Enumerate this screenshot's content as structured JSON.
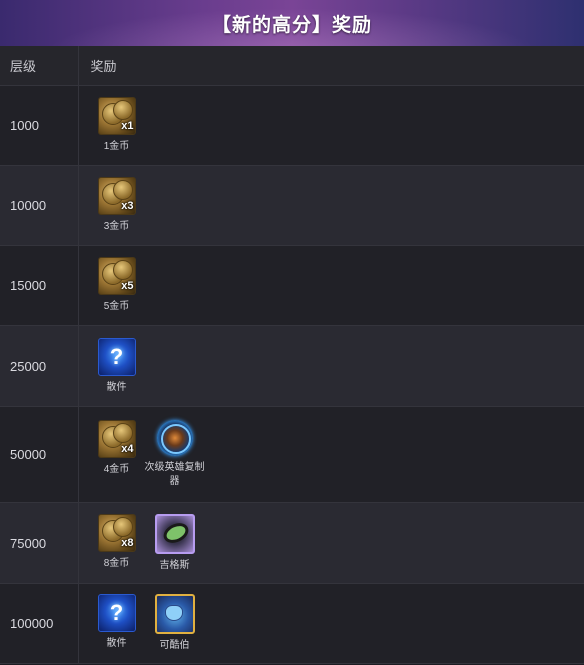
{
  "banner": {
    "title": "【新的高分】奖励"
  },
  "table": {
    "headers": {
      "tier": "层级",
      "reward": "奖励"
    },
    "rows": [
      {
        "tier": "1000",
        "rewards": [
          {
            "kind": "coin",
            "count": "x1",
            "label": "1金币"
          }
        ]
      },
      {
        "tier": "10000",
        "rewards": [
          {
            "kind": "coin",
            "count": "x3",
            "label": "3金币"
          }
        ]
      },
      {
        "tier": "15000",
        "rewards": [
          {
            "kind": "coin",
            "count": "x5",
            "label": "5金币"
          }
        ]
      },
      {
        "tier": "25000",
        "rewards": [
          {
            "kind": "mystery",
            "glyph": "?",
            "label": "散件"
          }
        ]
      },
      {
        "tier": "50000",
        "rewards": [
          {
            "kind": "coin",
            "count": "x4",
            "label": "4金币"
          },
          {
            "kind": "replicator",
            "label": "次级英雄复制器"
          }
        ]
      },
      {
        "tier": "75000",
        "rewards": [
          {
            "kind": "coin",
            "count": "x8",
            "label": "8金币"
          },
          {
            "kind": "zeke",
            "label": "吉格斯"
          }
        ]
      },
      {
        "tier": "100000",
        "rewards": [
          {
            "kind": "mystery",
            "glyph": "?",
            "label": "散件"
          },
          {
            "kind": "kobold",
            "label": "可酷伯"
          }
        ]
      }
    ]
  },
  "icons": {
    "coin": "gold-coins-icon",
    "mystery": "mystery-item-icon",
    "replicator": "minor-champion-replicator-icon",
    "zeke": "zeke-convergence-icon",
    "kobold": "kobold-icon"
  }
}
